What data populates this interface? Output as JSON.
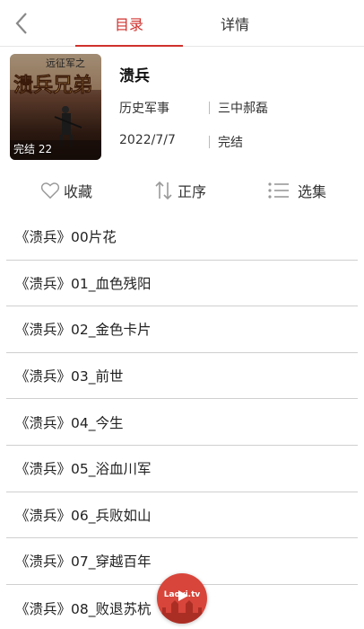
{
  "header": {
    "tabs": [
      {
        "label": "目录",
        "active": true
      },
      {
        "label": "详情",
        "active": false
      }
    ],
    "back_icon": "chevron-left-icon"
  },
  "book": {
    "title": "溃兵",
    "genre": "历史军事",
    "author": "三中郝磊",
    "date": "2022/7/7",
    "status": "完结",
    "cover_badge": "完结 22",
    "cover_art_text": [
      "远征军之",
      "溃兵兄弟"
    ]
  },
  "actions": {
    "favorite": "收藏",
    "order": "正序",
    "select": "选集"
  },
  "episodes": [
    "《溃兵》00片花",
    "《溃兵》01_血色残阳",
    "《溃兵》02_金色卡片",
    "《溃兵》03_前世",
    "《溃兵》04_今生",
    "《溃兵》05_浴血川军",
    "《溃兵》06_兵败如山",
    "《溃兵》07_穿越百年",
    "《溃兵》08_败退苏杭"
  ],
  "fab": {
    "label": "Laoyi.tv"
  },
  "colors": {
    "accent": "#d0312d",
    "divider": "#cfcfcf"
  }
}
